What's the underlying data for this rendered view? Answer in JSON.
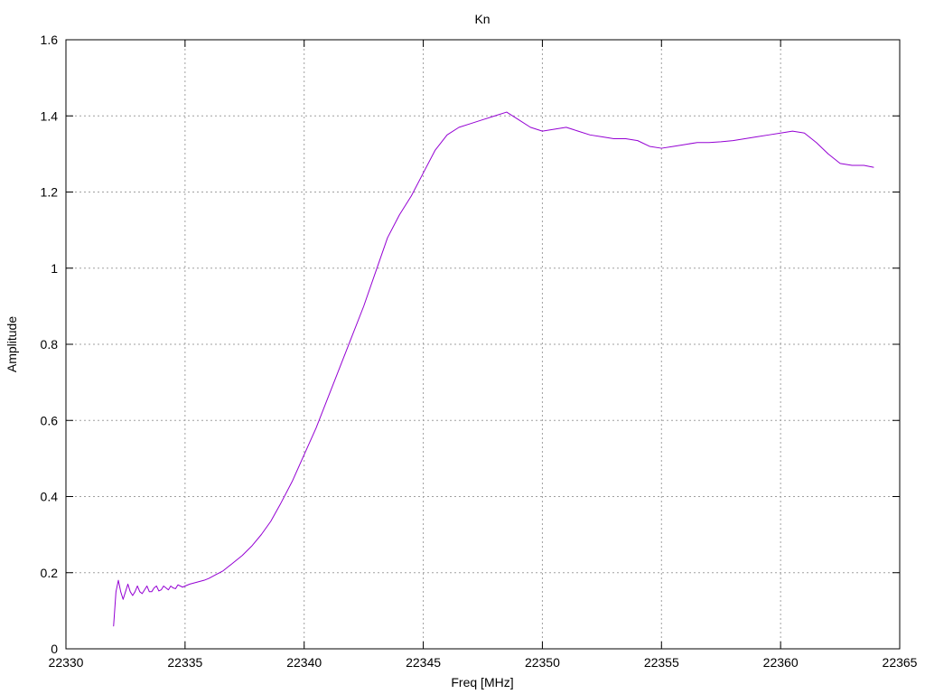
{
  "chart_data": {
    "type": "line",
    "title": "Kn",
    "xlabel": "Freq [MHz]",
    "ylabel": "Amplitude",
    "xlim": [
      22330,
      22365
    ],
    "ylim": [
      0,
      1.6
    ],
    "xticks": [
      22330,
      22335,
      22340,
      22345,
      22350,
      22355,
      22360,
      22365
    ],
    "yticks": [
      0,
      0.2,
      0.4,
      0.6,
      0.8,
      1,
      1.2,
      1.4,
      1.6
    ],
    "xtick_labels": [
      "22330",
      "22335",
      "22340",
      "22345",
      "22350",
      "22355",
      "22360",
      "22365"
    ],
    "ytick_labels": [
      "0",
      "0.2",
      "0.4",
      "0.6",
      "0.8",
      "1",
      "1.2",
      "1.4",
      "1.6"
    ],
    "grid": true,
    "legend": "none",
    "series": [
      {
        "color": "#9400D3",
        "x": [
          22332.0,
          22332.1,
          22332.2,
          22332.3,
          22332.4,
          22332.5,
          22332.6,
          22332.7,
          22332.8,
          22332.9,
          22333.0,
          22333.1,
          22333.2,
          22333.3,
          22333.4,
          22333.5,
          22333.6,
          22333.7,
          22333.8,
          22333.9,
          22334.0,
          22334.1,
          22334.2,
          22334.3,
          22334.4,
          22334.5,
          22334.6,
          22334.7,
          22334.8,
          22334.9,
          22335.0,
          22335.2,
          22335.5,
          22335.8,
          22336.0,
          22336.3,
          22336.6,
          22337.0,
          22337.4,
          22337.8,
          22338.2,
          22338.6,
          22339.0,
          22339.5,
          22340.0,
          22340.5,
          22341.0,
          22341.5,
          22342.0,
          22342.5,
          22343.0,
          22343.5,
          22344.0,
          22344.5,
          22345.0,
          22345.5,
          22346.0,
          22346.5,
          22347.0,
          22347.5,
          22348.0,
          22348.5,
          22349.0,
          22349.5,
          22350.0,
          22350.5,
          22351.0,
          22351.5,
          22352.0,
          22352.5,
          22353.0,
          22353.5,
          22354.0,
          22354.5,
          22355.0,
          22355.5,
          22356.0,
          22356.5,
          22357.0,
          22357.5,
          22358.0,
          22358.5,
          22359.0,
          22359.5,
          22360.0,
          22360.5,
          22361.0,
          22361.5,
          22362.0,
          22362.5,
          22363.0,
          22363.5,
          22363.9
        ],
        "y": [
          0.06,
          0.15,
          0.18,
          0.15,
          0.13,
          0.15,
          0.17,
          0.15,
          0.14,
          0.15,
          0.165,
          0.15,
          0.145,
          0.155,
          0.165,
          0.15,
          0.15,
          0.16,
          0.165,
          0.152,
          0.155,
          0.165,
          0.16,
          0.155,
          0.165,
          0.16,
          0.158,
          0.168,
          0.165,
          0.162,
          0.165,
          0.17,
          0.175,
          0.18,
          0.185,
          0.195,
          0.205,
          0.225,
          0.245,
          0.27,
          0.3,
          0.335,
          0.38,
          0.44,
          0.51,
          0.58,
          0.66,
          0.74,
          0.82,
          0.9,
          0.99,
          1.08,
          1.14,
          1.19,
          1.25,
          1.31,
          1.35,
          1.37,
          1.38,
          1.39,
          1.4,
          1.41,
          1.39,
          1.37,
          1.36,
          1.365,
          1.37,
          1.36,
          1.35,
          1.345,
          1.34,
          1.34,
          1.335,
          1.32,
          1.315,
          1.32,
          1.325,
          1.33,
          1.33,
          1.332,
          1.335,
          1.34,
          1.345,
          1.35,
          1.355,
          1.36,
          1.355,
          1.33,
          1.3,
          1.275,
          1.27,
          1.27,
          1.265
        ]
      }
    ]
  }
}
